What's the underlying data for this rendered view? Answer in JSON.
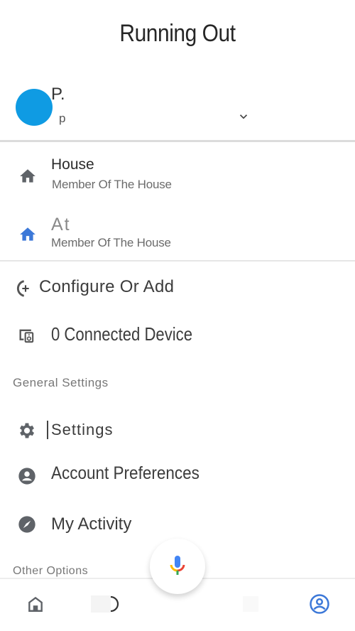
{
  "header": {
    "title": "Running Out"
  },
  "account": {
    "name": "P.",
    "email": "p",
    "avatar_color": "#0f9be3"
  },
  "homes": [
    {
      "name": "House",
      "role": "Member Of The House",
      "icon": "home-icon",
      "icon_color": "#5f6368"
    },
    {
      "name": "At",
      "role": "Member Of The House",
      "icon": "home-icon",
      "icon_color": "#3c78d8"
    }
  ],
  "actions": [
    {
      "label": "Configure Or Add",
      "icon": "add-circle-icon"
    },
    {
      "label": "0 Connected Device",
      "icon": "devices-icon"
    }
  ],
  "sections": {
    "general": "General Settings",
    "other": "Other Options"
  },
  "general_items": [
    {
      "label": "Settings",
      "icon": "gear-icon"
    },
    {
      "label": "Account Preferences",
      "icon": "account-circle-icon"
    },
    {
      "label": "My Activity",
      "icon": "compass-icon"
    }
  ],
  "bottom_nav": {
    "items": [
      "home",
      "explore",
      "assistant",
      "routines",
      "account"
    ],
    "active": "account",
    "accent": "#3c78d8"
  },
  "mic_colors": {
    "blue": "#4285f4",
    "red": "#ea4335",
    "yellow": "#fbbc04",
    "green": "#34a853"
  }
}
